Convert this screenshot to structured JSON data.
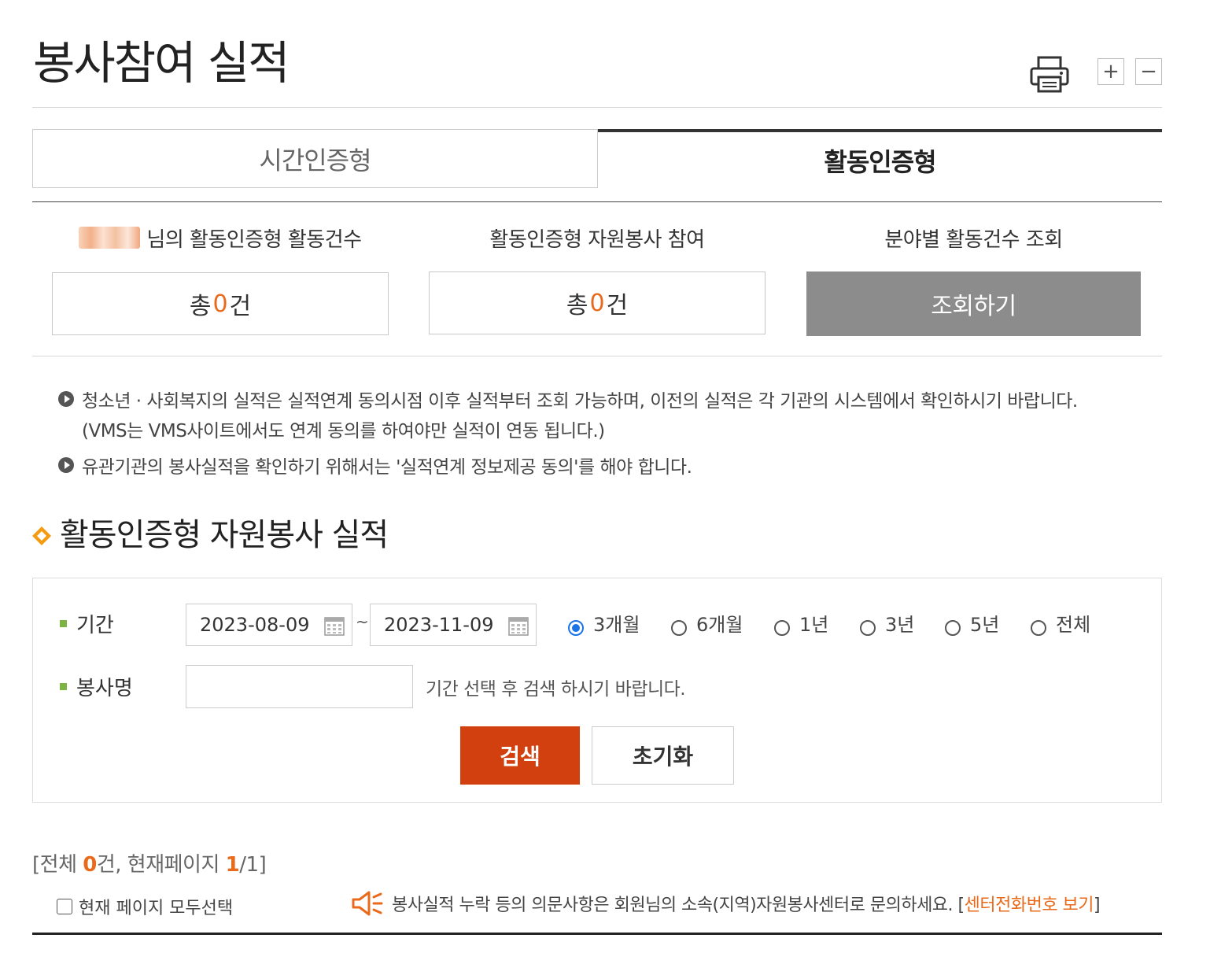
{
  "header": {
    "title": "봉사참여 실적",
    "zoom_in": "+",
    "zoom_out": "−"
  },
  "tabs": [
    {
      "label": "시간인증형",
      "active": false
    },
    {
      "label": "활동인증형",
      "active": true
    }
  ],
  "summary": {
    "col1_label_suffix": "님의 활동인증형 활동건수",
    "col2_label": "활동인증형 자원봉사 참여",
    "col3_label": "분야별 활동건수 조회",
    "box1": {
      "prefix": "총",
      "count": "0",
      "suffix": "건"
    },
    "box2": {
      "prefix": "총",
      "count": "0",
      "suffix": "건"
    },
    "lookup_button": "조회하기"
  },
  "notices": {
    "line1": "청소년 · 사회복지의 실적은 실적연계 동의시점 이후 실적부터 조회 가능하며, 이전의 실적은 각 기관의 시스템에서 확인하시기 바랍니다.",
    "line1b": "(VMS는 VMS사이트에서도 연계 동의를 하여야만 실적이 연동 됩니다.)",
    "line2": "유관기관의 봉사실적을 확인하기 위해서는 '실적연계 정보제공 동의'를 해야 합니다."
  },
  "section": {
    "title": "활동인증형 자원봉사 실적"
  },
  "search": {
    "period_label": "기간",
    "date_from": "2023-08-09",
    "tilde": "~",
    "date_to": "2023-11-09",
    "radios": [
      {
        "label": "3개월",
        "checked": true
      },
      {
        "label": "6개월",
        "checked": false
      },
      {
        "label": "1년",
        "checked": false
      },
      {
        "label": "3년",
        "checked": false
      },
      {
        "label": "5년",
        "checked": false
      },
      {
        "label": "전체",
        "checked": false
      }
    ],
    "name_label": "봉사명",
    "name_value": "",
    "hint": "기간 선택 후 검색 하시기 바랍니다.",
    "search_button": "검색",
    "reset_button": "초기화"
  },
  "results": {
    "info_prefix": "[전체 ",
    "total": "0",
    "info_mid": "건, 현재페이지 ",
    "current_page": "1",
    "info_suffix": "/1]",
    "select_all": "현재 페이지 모두선택",
    "inquiry_text": "봉사실적 누락 등의 의문사항은 회원님의 소속(지역)자원봉사센터로 문의하세요. [",
    "inquiry_link": "센터전화번호 보기",
    "inquiry_end": "]"
  },
  "colors": {
    "accent_orange": "#e86a1a",
    "search_button": "#d2400f",
    "lookup_button": "#8c8c8c",
    "radio_checked": "#1a73e8",
    "label_marker": "#7cb342"
  }
}
